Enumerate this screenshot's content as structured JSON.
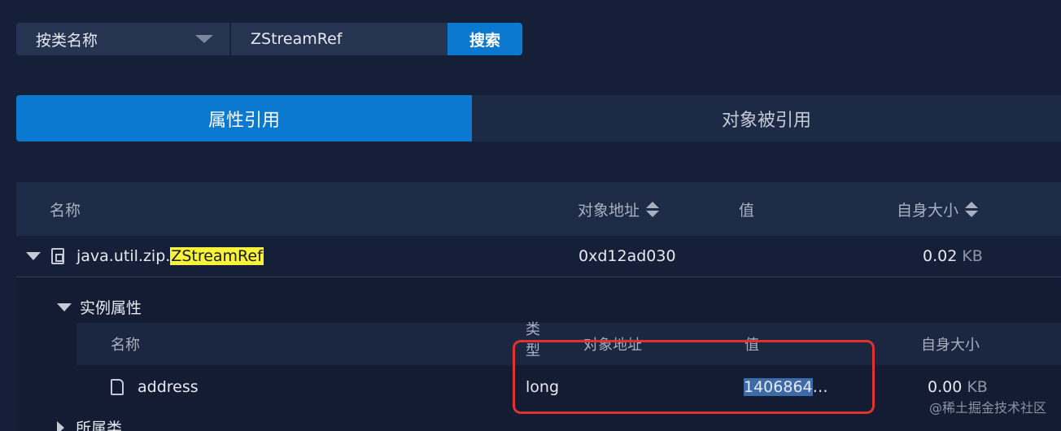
{
  "search": {
    "type_select": "按类名称",
    "query_value": "ZStreamRef",
    "button_label": "搜索"
  },
  "tabs": [
    {
      "label": "属性引用",
      "active": true
    },
    {
      "label": "对象被引用",
      "active": false
    }
  ],
  "table": {
    "headers": {
      "name": "名称",
      "address": "对象地址",
      "value": "值",
      "size": "自身大小"
    },
    "main_row": {
      "name_prefix": "java.util.zip.",
      "name_highlight": "ZStreamRef",
      "address": "0xd12ad030",
      "size_value": "0.02",
      "size_unit": "KB"
    },
    "instance_section": {
      "title": "实例属性",
      "headers": {
        "name": "名称",
        "type": "类型",
        "address": "对象地址",
        "value": "值",
        "size": "自身大小"
      },
      "rows": [
        {
          "name": "address",
          "type": "long",
          "address": "",
          "value": "1406864",
          "value_suffix": "…",
          "size_value": "0.00",
          "size_unit": "KB"
        }
      ]
    },
    "parent_section": {
      "title": "所属类"
    }
  },
  "watermark": "@稀土掘金技术社区",
  "colors": {
    "background": "#151f37",
    "accent": "#0c79d0",
    "highlight": "#f8f23a",
    "annotation": "#e0322f"
  }
}
